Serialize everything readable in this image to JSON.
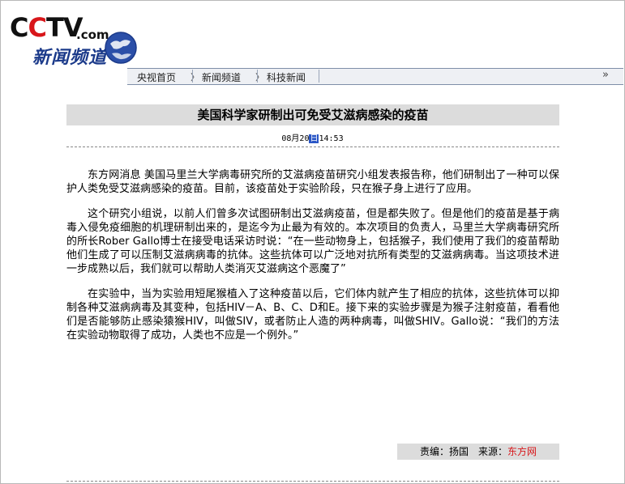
{
  "logo": {
    "brand_c1": "C",
    "brand_c2": "C",
    "brand_tv": "TV",
    "brand_com": ".com",
    "channel": "新闻频道"
  },
  "nav": {
    "items": [
      {
        "label": "央视首页"
      },
      {
        "label": "新闻频道"
      },
      {
        "label": "科技新闻"
      }
    ],
    "arrow": "〉",
    "end": "»"
  },
  "article": {
    "title": "美国科学家研制出可免受艾滋病感染的疫苗",
    "date_prefix": "08月20",
    "date_highlight": "日",
    "date_time": "14:53",
    "paragraphs": [
      "东方网消息 美国马里兰大学病毒研究所的艾滋病疫苗研究小组发表报告称，他们研制出了一种可以保护人类免受艾滋病感染的疫苗。目前，该疫苗处于实验阶段，只在猴子身上进行了应用。",
      "这个研究小组说，以前人们曾多次试图研制出艾滋病疫苗，但是都失败了。但是他们的疫苗是基于病毒入侵免疫细胞的机理研制出来的，是迄今为止最为有效的。本次项目的负责人，马里兰大学病毒研究所的所长Rober Gallo博士在接受电话采访时说：“在一些动物身上，包括猴子，我们使用了我们的疫苗帮助他们生成了可以压制艾滋病病毒的抗体。这些抗体可以广泛地对抗所有类型的艾滋病病毒。当这项技术进一步成熟以后，我们就可以帮助人类消灭艾滋病这个恶魔了”",
      "在实验中，当为实验用短尾猴植入了这种疫苗以后，它们体内就产生了相应的抗体，这些抗体可以抑制各种艾滋病病毒及其变种，包括HIV－A、B、C、D和E。接下来的实验步骤是为猴子注射疫苗，看看他们是否能够防止感染猿猴HIV，叫做SIV，或者防止人造的两种病毒，叫做SHIV。Gallo说：“我们的方法在实验动物取得了成功，人类也不应是一个例外。”"
    ],
    "credit_label": "责编：扬国　来源：",
    "credit_source": "东方网"
  },
  "colors": {
    "brand_red": "#d8161a",
    "channel_blue": "#1b3a8a",
    "title_bar_bg": "#dcdcdc",
    "date_highlight": "#2a56c6"
  }
}
